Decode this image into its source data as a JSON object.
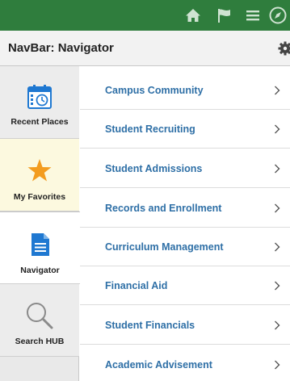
{
  "header": {
    "title": "NavBar: Navigator"
  },
  "topbar": {
    "icons": [
      "home-icon",
      "flag-icon",
      "menu-icon",
      "compass-icon"
    ]
  },
  "sidebar": {
    "items": [
      {
        "label": "Recent Places",
        "icon": "calendar-clock-icon"
      },
      {
        "label": "My Favorites",
        "icon": "star-icon"
      },
      {
        "label": "Navigator",
        "icon": "document-icon",
        "selected": true
      },
      {
        "label": "Search HUB",
        "icon": "magnifier-icon"
      }
    ]
  },
  "menu": {
    "items": [
      {
        "label": "Campus Community"
      },
      {
        "label": "Student Recruiting"
      },
      {
        "label": "Student Admissions"
      },
      {
        "label": "Records and Enrollment"
      },
      {
        "label": "Curriculum Management"
      },
      {
        "label": "Financial Aid"
      },
      {
        "label": "Student Financials"
      },
      {
        "label": "Academic Advisement"
      }
    ]
  },
  "colors": {
    "topbar": "#2f7d3d",
    "link": "#2e6fa6",
    "favorite_bg": "#fcf9df",
    "star": "#f39c1f",
    "icon_blue": "#1f78d1"
  }
}
